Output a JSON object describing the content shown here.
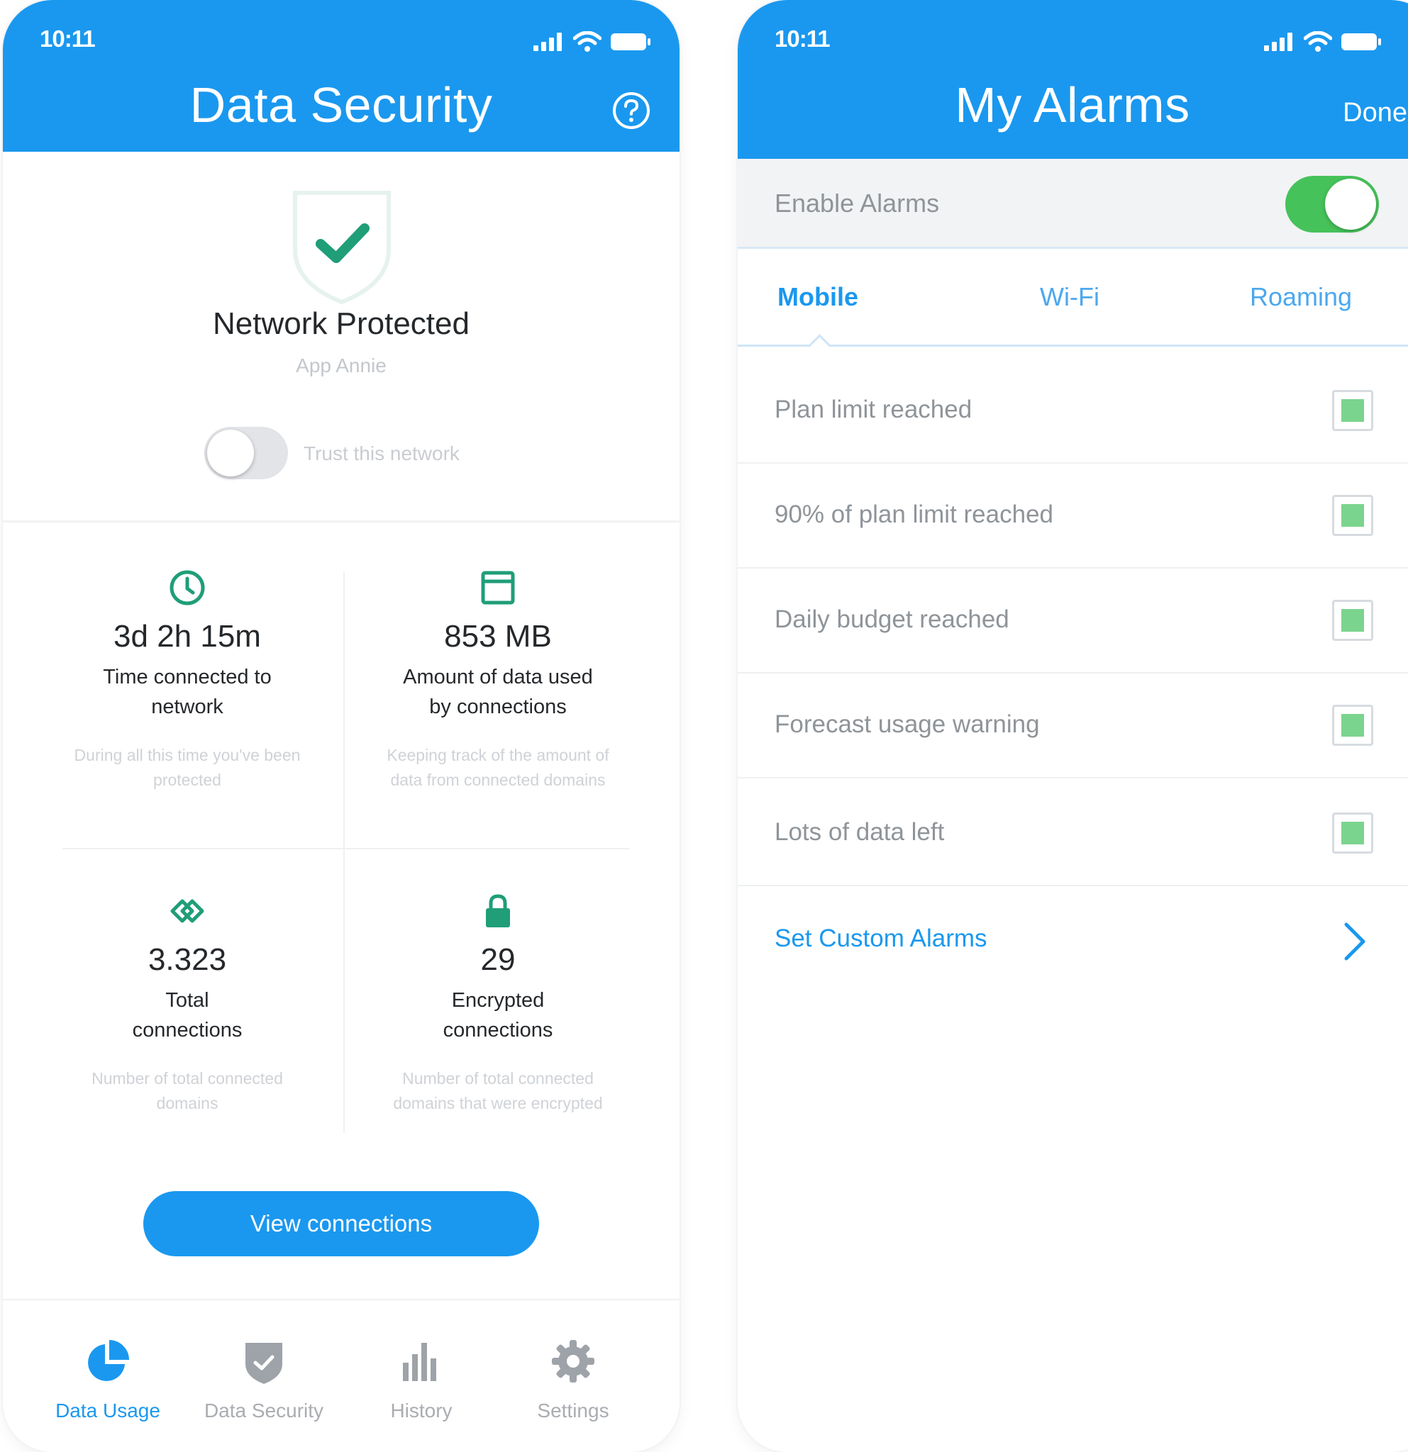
{
  "colors": {
    "brand_blue": "#1a98ef",
    "check_green": "#7bd48d",
    "toggle_green": "#46c25a",
    "shield_check_green": "#1f9e78"
  },
  "left_screen": {
    "status_time": "10:11",
    "title": "Data Security",
    "help_icon": "help-circle-icon",
    "status": {
      "title": "Network Protected",
      "network": "App Annie",
      "trust_label": "Trust this network",
      "trust_enabled": false
    },
    "stats": [
      {
        "icon": "clock-icon",
        "value": "3d 2h 15m",
        "label": "Time connected to\nnetwork",
        "desc": "During all this time you've been\nprotected"
      },
      {
        "icon": "calendar-icon",
        "value": "853 MB",
        "label": "Amount of data used\nby connections",
        "desc": "Keeping track of the amount of\ndata from connected domains"
      },
      {
        "icon": "connections-icon",
        "value": "3.323",
        "label": "Total\nconnections",
        "desc": "Number of total connected\ndomains"
      },
      {
        "icon": "lock-icon",
        "value": "29",
        "label": "Encrypted\nconnections",
        "desc": "Number of total connected\ndomains that were encrypted"
      }
    ],
    "view_button": "View connections",
    "tabbar": [
      {
        "label": "Data Usage",
        "icon": "pie-chart-icon",
        "active": true
      },
      {
        "label": "Data Security",
        "icon": "shield-check-icon",
        "active": false
      },
      {
        "label": "History",
        "icon": "bar-chart-icon",
        "active": false
      },
      {
        "label": "Settings",
        "icon": "gear-icon",
        "active": false
      }
    ]
  },
  "right_screen": {
    "status_time": "10:11",
    "title": "My Alarms",
    "done_label": "Done",
    "enable_label": "Enable Alarms",
    "enable_on": true,
    "tabs": [
      {
        "label": "Mobile",
        "active": true
      },
      {
        "label": "Wi-Fi",
        "active": false
      },
      {
        "label": "Roaming",
        "active": false
      }
    ],
    "alarms": [
      {
        "label": "Plan limit reached",
        "checked": true
      },
      {
        "label": "90% of plan limit reached",
        "checked": true
      },
      {
        "label": "Daily budget reached",
        "checked": true
      },
      {
        "label": "Forecast usage warning",
        "checked": true
      },
      {
        "label": "Lots of data left",
        "checked": true
      }
    ],
    "custom_alarms_label": "Set Custom Alarms"
  }
}
